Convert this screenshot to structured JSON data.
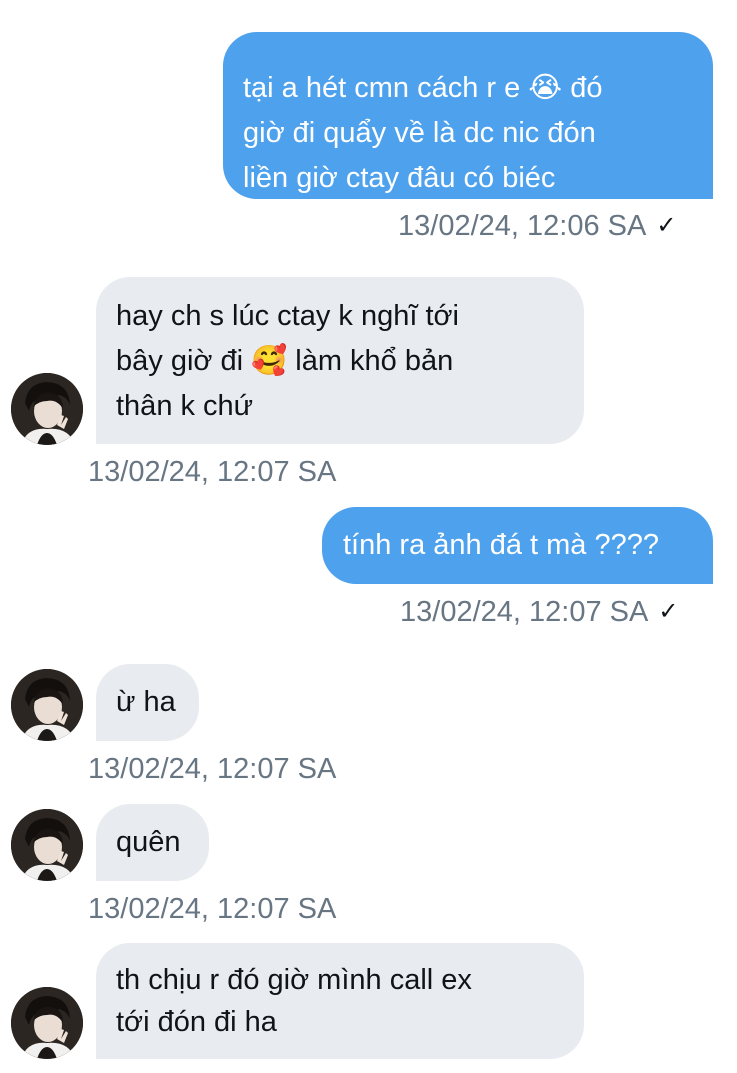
{
  "messages": [
    {
      "direction": "outgoing",
      "lines": [
        "tại a hét cmn cách r e 😭  đó",
        "giờ đi quẩy về là dc nic đón",
        "liền giờ ctay đâu có biéc"
      ],
      "timestamp": "13/02/24, 12:06 SA",
      "status_icon": "check-icon"
    },
    {
      "direction": "incoming",
      "lines": [
        "hay ch s lúc ctay k nghĩ tới",
        "bây giờ đi 🥰  làm khổ bản",
        "thân k chứ"
      ],
      "timestamp": "13/02/24, 12:07 SA",
      "has_avatar": true
    },
    {
      "direction": "outgoing",
      "lines": [
        "tính ra ảnh đá t mà ????"
      ],
      "timestamp": "13/02/24, 12:07 SA",
      "status_icon": "check-icon"
    },
    {
      "direction": "incoming",
      "lines": [
        "ừ ha"
      ],
      "timestamp": "13/02/24, 12:07 SA",
      "has_avatar": true
    },
    {
      "direction": "incoming",
      "lines": [
        "quên"
      ],
      "timestamp": "13/02/24, 12:07 SA",
      "has_avatar": true
    },
    {
      "direction": "incoming",
      "lines": [
        "th chịu r đó giờ mình call ex",
        "tới đón đi ha"
      ],
      "has_avatar": true
    }
  ],
  "check_glyph": "✓",
  "colors": {
    "outgoing_bubble": "#4ea1ec",
    "incoming_bubble": "#e8ebef",
    "timestamp_text": "#687684"
  }
}
